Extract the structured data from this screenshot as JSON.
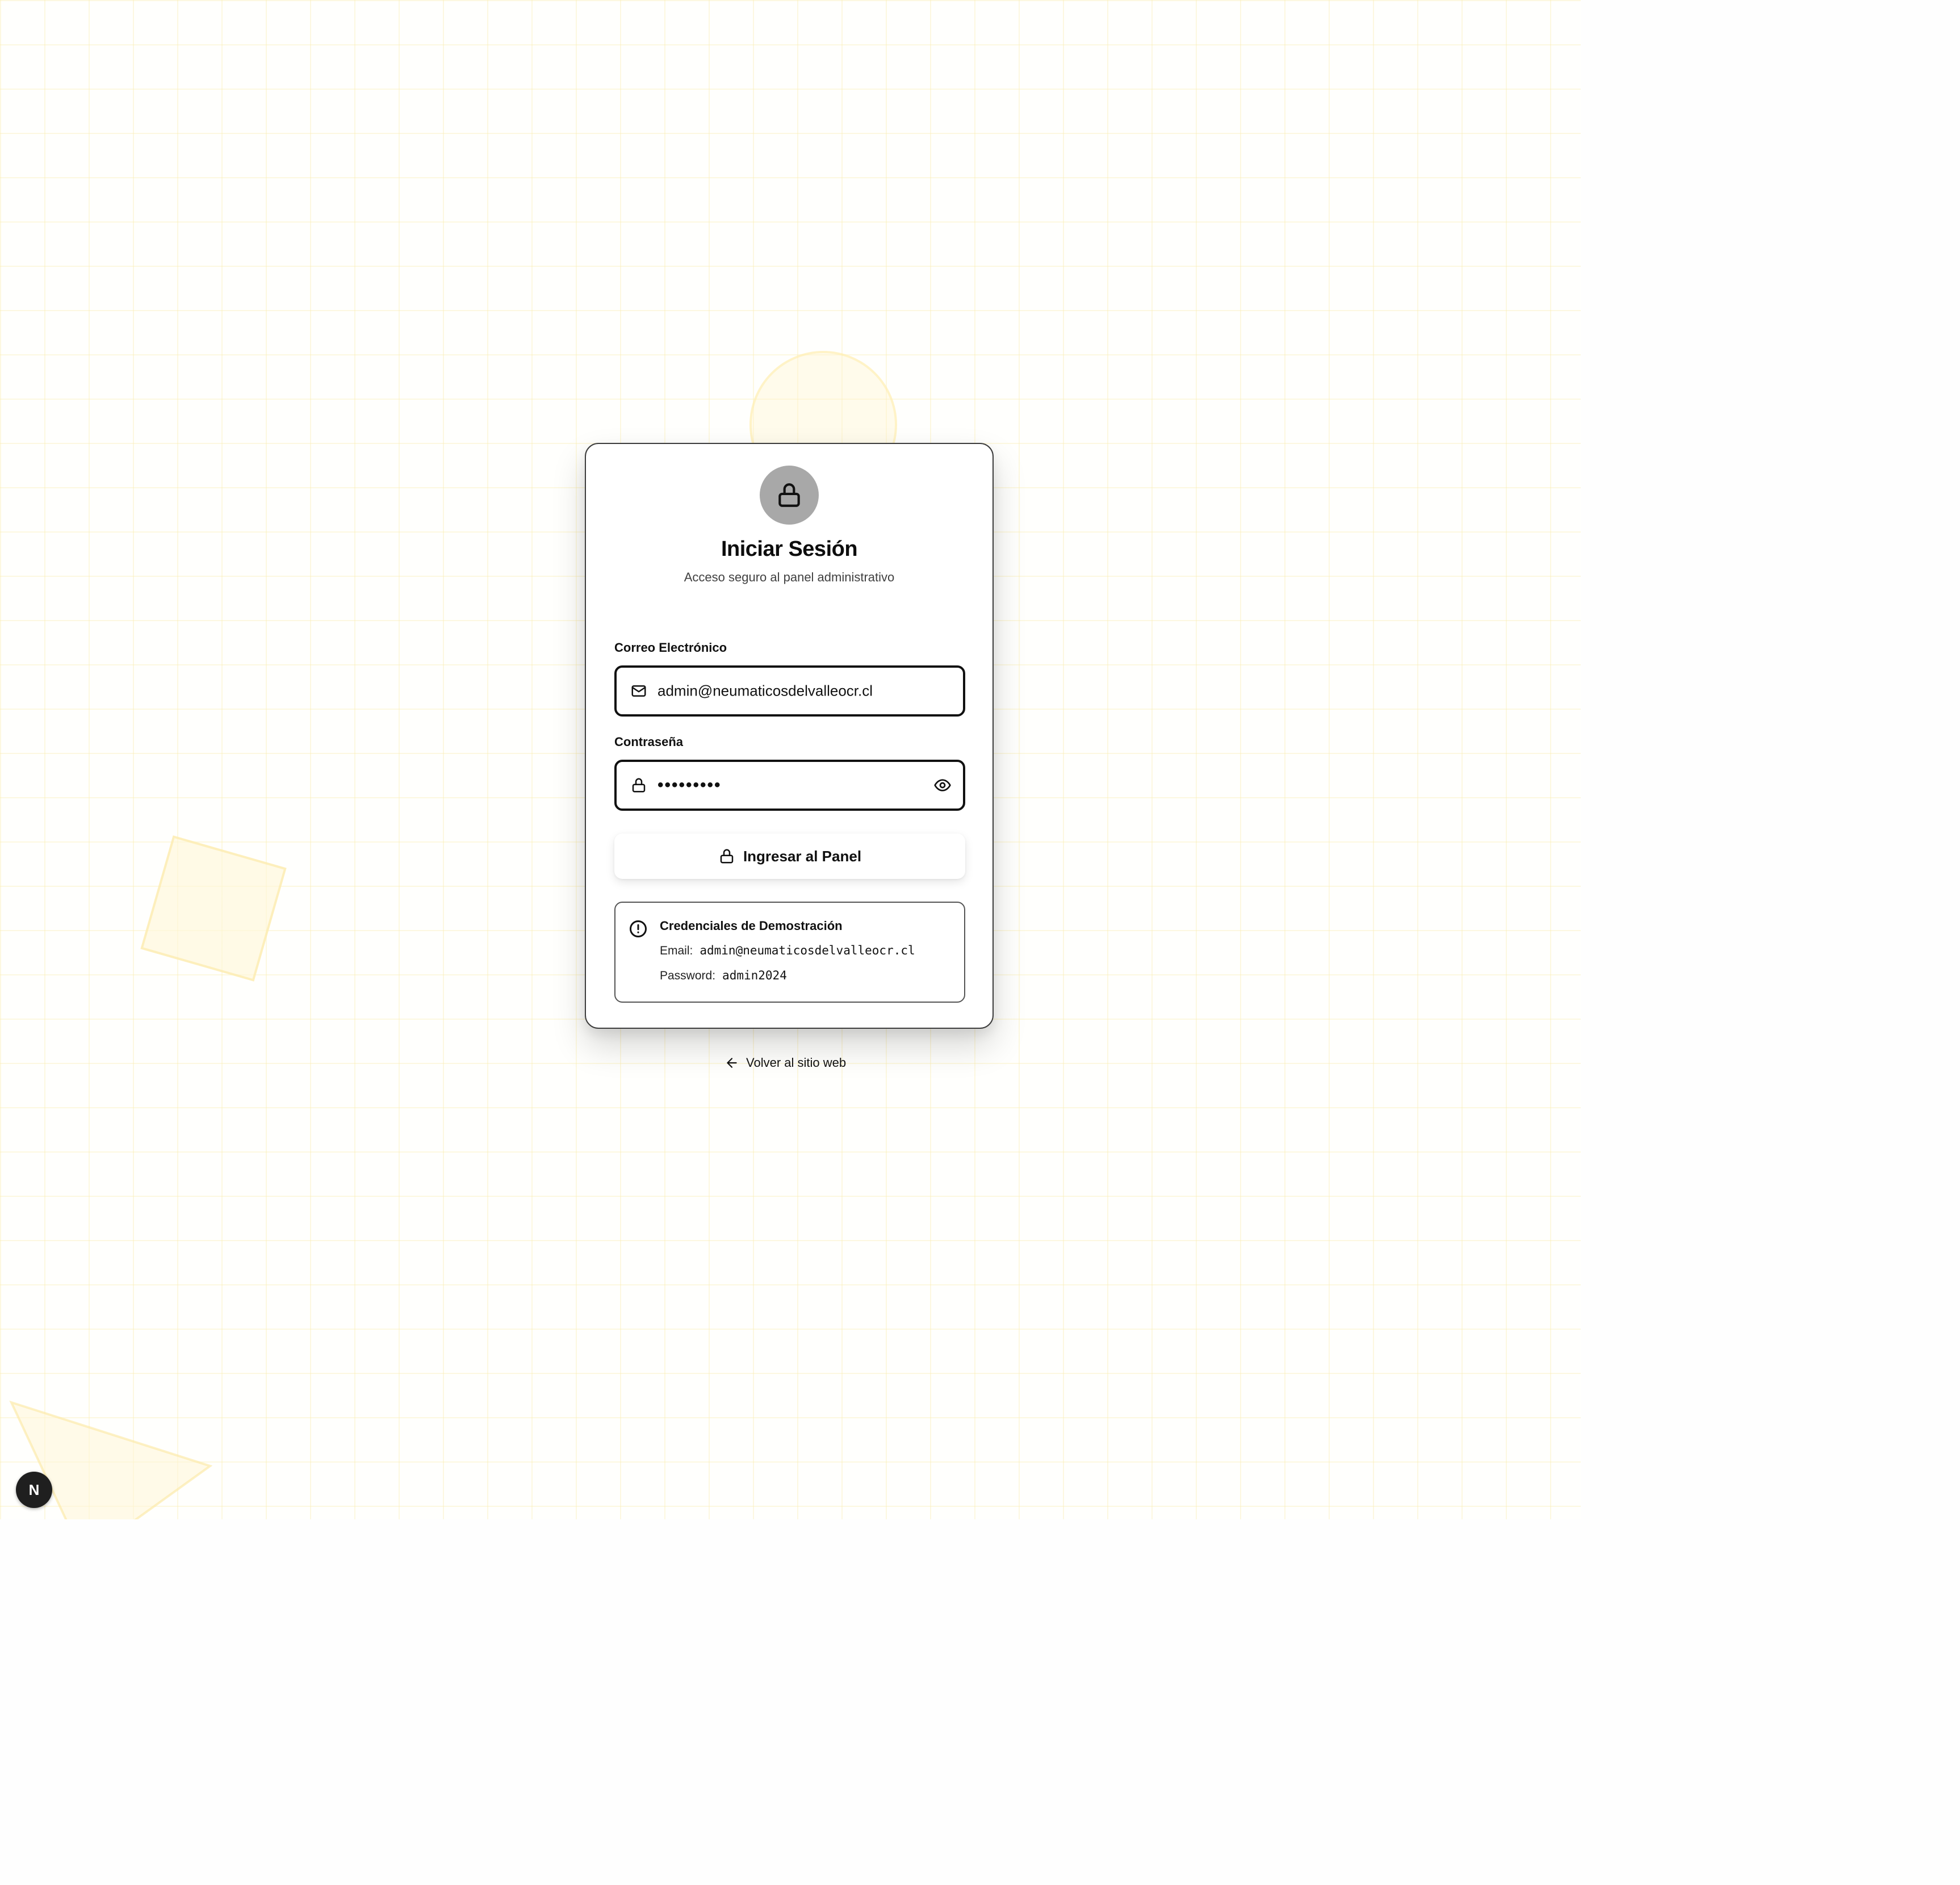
{
  "login": {
    "title": "Iniciar Sesión",
    "subtitle": "Acceso seguro al panel administrativo",
    "email_label": "Correo Electrónico",
    "email_value": "admin@neumaticosdelvalleocr.cl",
    "password_label": "Contraseña",
    "password_masked": "•••••••••",
    "submit_label": "Ingresar al Panel"
  },
  "demo": {
    "title": "Credenciales de Demostración",
    "email_key": "Email:",
    "email_value": "admin@neumaticosdelvalleocr.cl",
    "password_key": "Password:",
    "password_value": "admin2024"
  },
  "back_link": {
    "label": "Volver al sitio web"
  },
  "dev_badge": {
    "letter": "N"
  },
  "icons": {
    "avatar": "lock-icon",
    "email": "mail-icon",
    "password": "lock-icon",
    "toggle": "eye-icon",
    "submit": "lock-icon",
    "info": "alert-circle-icon",
    "back": "arrow-left-icon"
  },
  "colors": {
    "background_grid": "#faecaa",
    "accent_yellow": "#fff3c8",
    "avatar_bg": "#a8a8a8",
    "border": "#111111",
    "badge_bg": "#1f1f1f"
  }
}
